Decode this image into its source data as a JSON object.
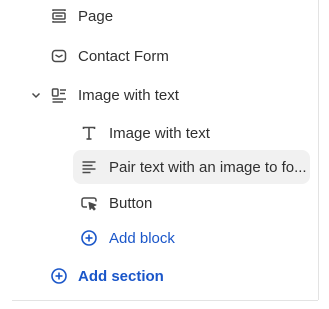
{
  "tree": {
    "items": [
      {
        "label": "Page",
        "icon": "page-section-icon"
      },
      {
        "label": "Contact Form",
        "icon": "contact-form-icon"
      },
      {
        "label": "Image with text",
        "icon": "image-with-text-icon",
        "expanded": true,
        "children": [
          {
            "label": "Image with text",
            "icon": "text-heading-icon"
          },
          {
            "label": "Pair text with an image to fo...",
            "icon": "paragraph-icon",
            "selected": true
          },
          {
            "label": "Button",
            "icon": "button-cursor-icon"
          }
        ],
        "add_block_label": "Add block"
      }
    ],
    "add_section_label": "Add section"
  },
  "colors": {
    "accent": "#1a56c9",
    "text": "#303030",
    "selected_bg": "#f1f1f1",
    "border": "#e3e3e3"
  }
}
